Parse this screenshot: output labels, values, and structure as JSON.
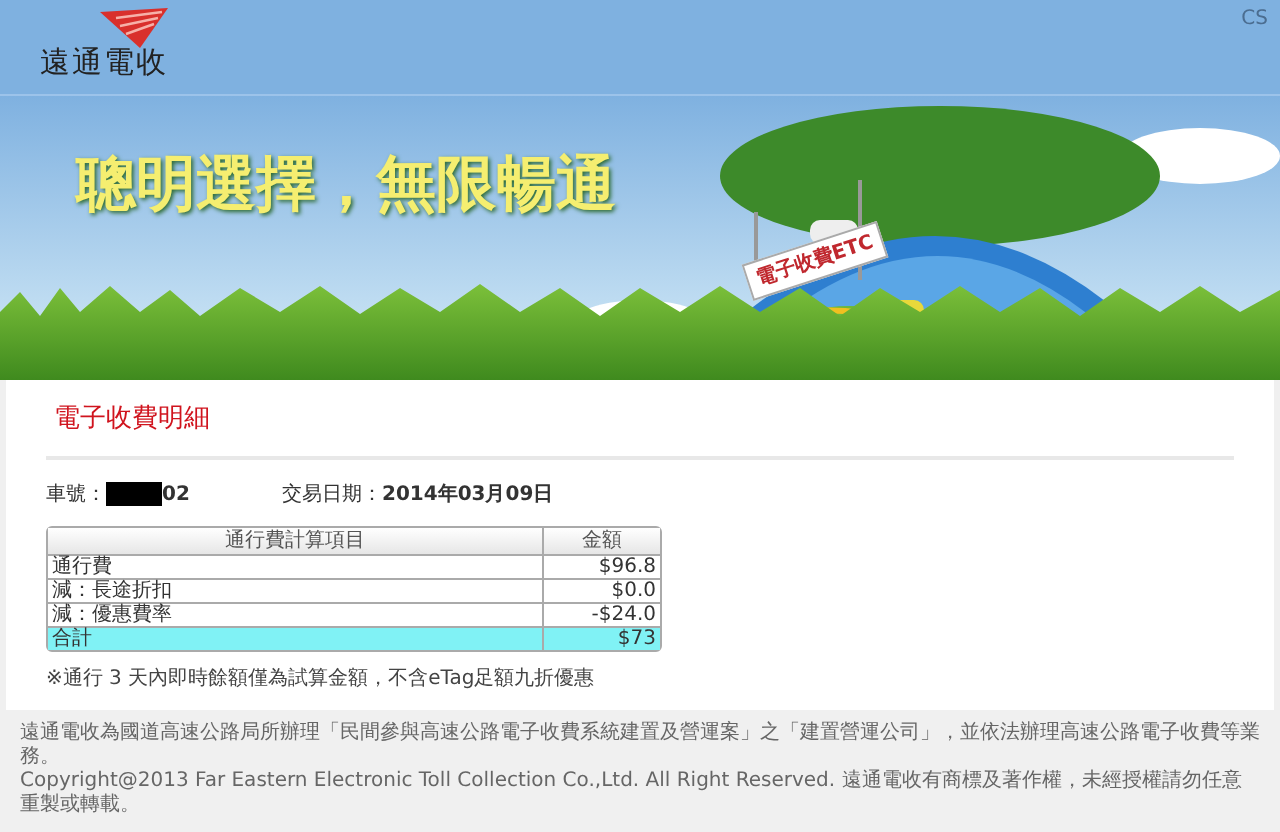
{
  "header": {
    "logo_text": "遠通電收",
    "corner_text": "CS"
  },
  "banner": {
    "slogan": "聰明選擇，無限暢通",
    "sign_text": "電子收費ETC"
  },
  "content": {
    "title": "電子收費明細",
    "plate": {
      "label": "車號：",
      "redacted": true,
      "visible_suffix": "02"
    },
    "date": {
      "label": "交易日期：",
      "value": "2014年03月09日"
    },
    "table": {
      "columns": [
        "通行費計算項目",
        "金額"
      ],
      "rows": [
        {
          "kind": "item",
          "item": "通行費",
          "amount": "$96.8"
        },
        {
          "kind": "item",
          "item": "減：長途折扣",
          "amount": "$0.0"
        },
        {
          "kind": "item",
          "item": "減：優惠費率",
          "amount": "-$24.0"
        },
        {
          "kind": "total",
          "item": "合計",
          "amount": "$73"
        }
      ]
    },
    "note": "※通行 3 天內即時餘額僅為試算金額，不含eTag足額九折優惠"
  },
  "footer": {
    "lines": [
      "遠通電收為國道高速公路局所辦理「民間參與高速公路電子收費系統建置及營運案」之「建置營運公司」，並依法辦理高速公路電子收費等業務。",
      "Copyright@2013 Far Eastern Electronic Toll Collection Co.,Ltd. All Right Reserved. 遠通電收有商標及著作權，未經授權請勿任意重製或轉載。"
    ]
  }
}
